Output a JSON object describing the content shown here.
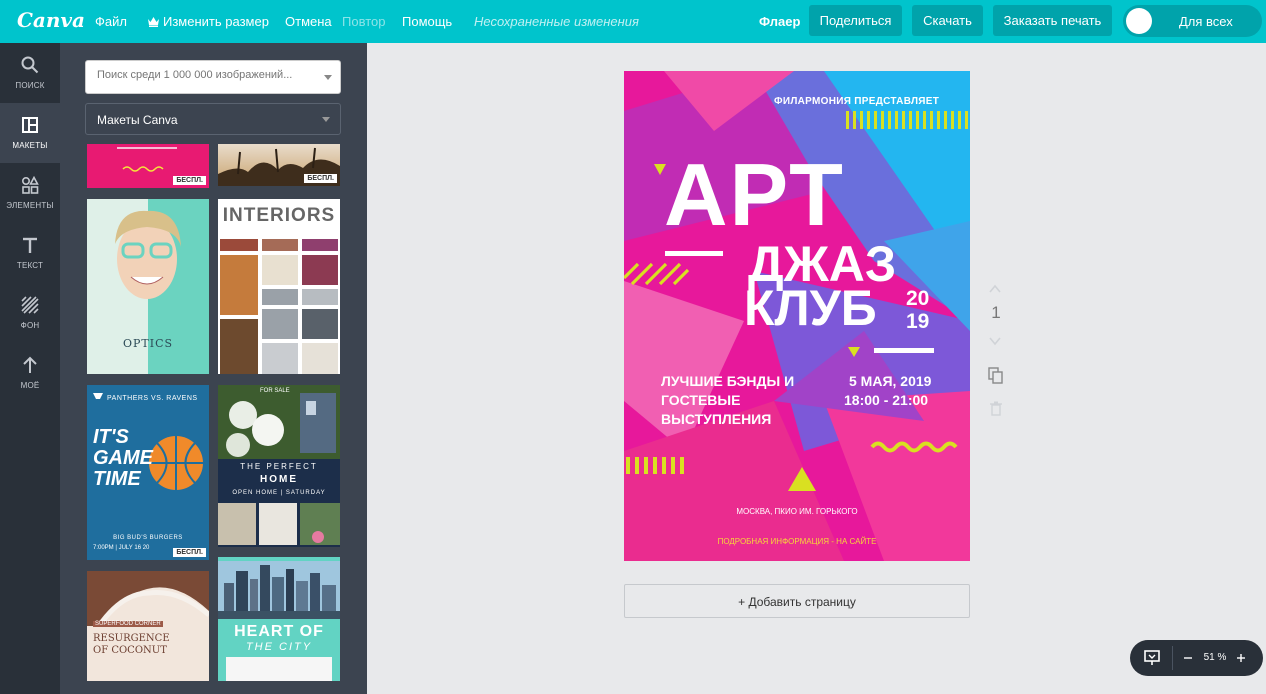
{
  "app": {
    "logo": "Canva"
  },
  "topbar": {
    "menu": {
      "file": "Файл",
      "resize": "Изменить размер",
      "undo": "Отмена",
      "redo": "Повтор",
      "help": "Помощь"
    },
    "unsaved": "Несохраненные изменения",
    "doc_type": "Флаер",
    "share": "Поделиться",
    "download": "Скачать",
    "print": "Заказать печать",
    "visibility": "Для всех"
  },
  "rail": {
    "search": "ПОИСК",
    "layouts": "МАКЕТЫ",
    "elements": "ЭЛЕМЕНТЫ",
    "text": "ТЕКСТ",
    "background": "ФОН",
    "mine": "МОЁ"
  },
  "panel": {
    "search_placeholder": "Поиск среди 1 000 000 изображений...",
    "layout_select": "Макеты Canva",
    "free_badge": "БЕСПЛ.",
    "thumbs": {
      "interiors_title": "INTERIORS",
      "optics_title": "OPTICS",
      "game_header": "PANTHERS VS. RAVENS",
      "game_title": "IT'S GAME TIME",
      "game_footer": "BIG BUD'S BURGERS",
      "game_date": "7:00PM | JULY 16 20",
      "home_line1": "THE PERFECT",
      "home_line2": "HOME",
      "home_line3": "OPEN HOME | SATURDAY",
      "home_tag": "FOR SALE",
      "coconut_tag": "SUPERFOOD CORNER",
      "coconut_title1": "RESURGENCE",
      "coconut_title2": "OF COCONUT",
      "city_title1": "HEART OF",
      "city_title2": "THE CITY"
    }
  },
  "poster": {
    "presenter": "ФИЛАРМОНИЯ ПРЕДСТАВЛЯЕТ",
    "title1": "АРТ",
    "title2": "ДЖАЗ",
    "title3": "КЛУБ",
    "year1": "20",
    "year2": "19",
    "desc1": "ЛУЧШИЕ БЭНДЫ И",
    "desc2": "ГОСТЕВЫЕ",
    "desc3": "ВЫСТУПЛЕНИЯ",
    "date": "5 МАЯ, 2019",
    "time": "18:00 - 21:00",
    "place": "МОСКВА, ПКИО ИМ. ГОРЬКОГО",
    "info": "ПОДРОБНАЯ ИНФОРМАЦИЯ - НА САЙТЕ"
  },
  "canvas": {
    "add_page": "+ Добавить страницу",
    "page_number": "1",
    "zoom": "51 %"
  },
  "colors": {
    "brand": "#00c4cc",
    "brand_dark": "#00a3ab",
    "rail": "#293039",
    "panel": "#3c4450",
    "poster_pink": "#e7189b",
    "poster_blue": "#23b6f0",
    "poster_yellow": "#d9e021"
  }
}
